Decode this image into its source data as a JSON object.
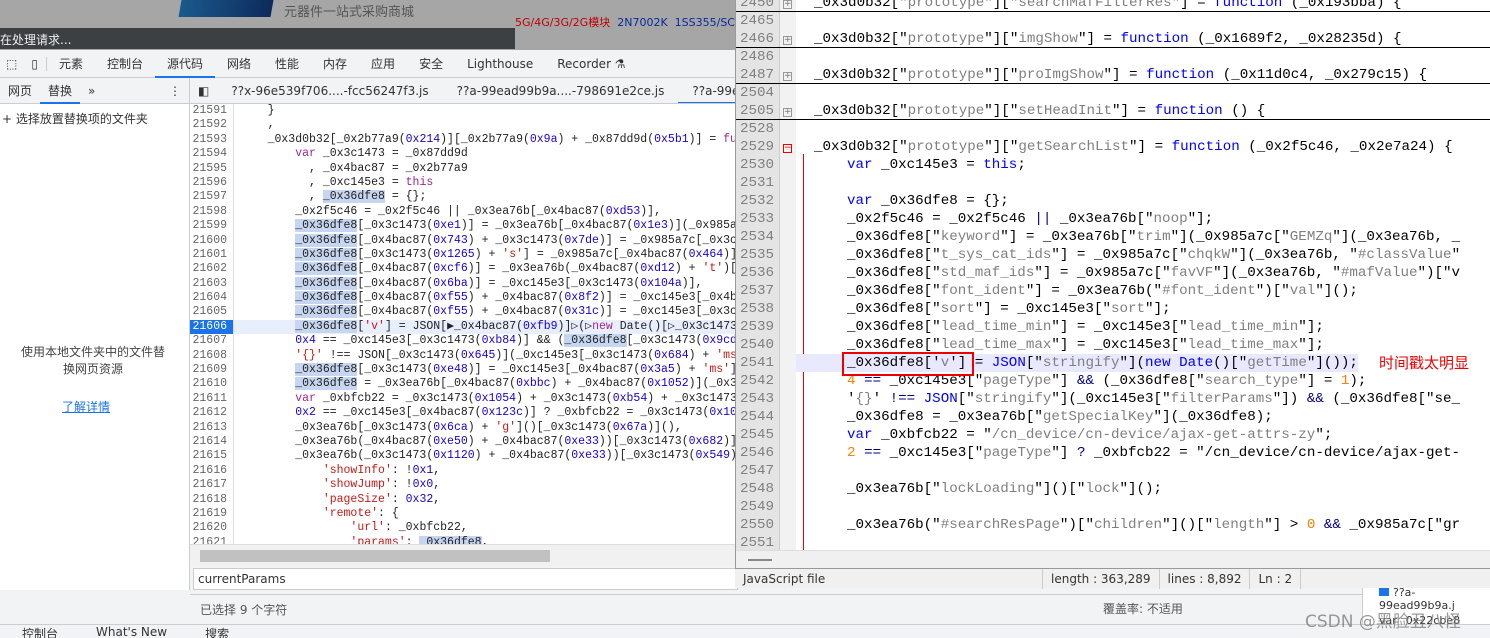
{
  "browser": {
    "slogan": "元器件一站式采购商城",
    "hot_red": "5G/4G/3G/2G模块",
    "hot_links": [
      "2N7002K",
      "1SS355/SC"
    ],
    "loading": "在处理请求..."
  },
  "devtools": {
    "tabs": [
      "元素",
      "控制台",
      "源代码",
      "网络",
      "性能",
      "内存",
      "应用",
      "安全",
      "Lighthouse",
      "Recorder ⚗"
    ],
    "active_tab": "源代码",
    "sub_tabs": [
      "网页",
      "替换",
      "»"
    ],
    "active_sub": "替换",
    "files": [
      "??x-96e539f706....-fcc56247f3.js",
      "??a-99ead99b9a....-798691e2ce.js",
      "??a-99ead99b9a....e"
    ],
    "side": {
      "add_folder": "+ 选择放置替换项的文件夹",
      "desc": "使用本地文件夹中的文件替换网页资源",
      "learn_more": "了解详情"
    },
    "current_line": 21606,
    "code_lines": [
      [
        21591,
        "    }"
      ],
      [
        21592,
        "    ,"
      ],
      [
        21593,
        "    _0x3d0b32[_0x2b77a9(0x214)][_0x2b77a9(0x9a) + _0x87dd9d(0x5b1)] = function"
      ],
      [
        21594,
        "        var _0x3c1473 = _0x87dd9d"
      ],
      [
        21595,
        "          , _0x4bac87 = _0x2b77a9"
      ],
      [
        21596,
        "          , _0xc145e3 = this"
      ],
      [
        21597,
        "          , _0x36dfe8 = {};"
      ],
      [
        21598,
        "        _0x2f5c46 = _0x2f5c46 || _0x3ea76b[_0x4bac87(0xd53)],"
      ],
      [
        21599,
        "        _0x36dfe8[_0x3c1473(0xe1)] = _0x3ea76b[_0x4bac87(0x1e3)](_0x985a7c["
      ],
      [
        21600,
        "        _0x36dfe8[_0x4bac87(0x743) + _0x3c1473(0x7de)] = _0x985a7c[_0x3c147"
      ],
      [
        21601,
        "        _0x36dfe8[_0x3c1473(0x1265) + 's'] = _0x985a7c[_0x4bac87(0x464)](_0"
      ],
      [
        21602,
        "        _0x36dfe8[_0x4bac87(0xcf6)] = _0x3ea76b(_0x4bac87(0xd12) + 't')[_0x"
      ],
      [
        21603,
        "        _0x36dfe8[_0x4bac87(0x6ba)] = _0xc145e3[_0x3c1473(0x104a)],"
      ],
      [
        21604,
        "        _0x36dfe8[_0x4bac87(0xf55) + _0x4bac87(0x8f2)] = _0xc145e3[_0x4bac8"
      ],
      [
        21605,
        "        _0x36dfe8[_0x4bac87(0xf55) + _0x4bac87(0x31c)] = _0xc145e3[_0x3c147"
      ],
      [
        21606,
        "        _0x36dfe8['v'] = JSON[▶_0x4bac87(0xfb9)]▷(▷new Date()[▷_0x3c1473("
      ],
      [
        21607,
        "        0x4 == _0xc145e3[_0x3c1473(0xb84)] && (_0x36dfe8[_0x3c1473(0x9cd) +"
      ],
      [
        21608,
        "        '{}' !== JSON[_0x3c1473(0x645)](_0xc145e3[_0x3c1473(0x684) + 'ms'])"
      ],
      [
        21609,
        "        _0x36dfe8[_0x3c1473(0xe48)] = _0xc145e3[_0x4bac87(0x3a5) + 'ms']),"
      ],
      [
        21610,
        "        _0x36dfe8 = _0x3ea76b[_0x4bac87(0xbbc) + _0x4bac87(0x1052)](_0x36df"
      ],
      [
        21611,
        "        var _0xbfcb22 = _0x3c1473(0x1054) + _0x3c1473(0xb54) + _0x3c1473(0x"
      ],
      [
        21612,
        "        0x2 == _0xc145e3[_0x4bac87(0x123c)] ? _0xbfcb22 = _0x3c1473(0x1054)"
      ],
      [
        21613,
        "        _0x3ea76b[_0x3c1473(0x6ca) + 'g']()[_0x3c1473(0x67a)](),"
      ],
      [
        21614,
        "        _0x3ea76b(_0x4bac87(0xe50) + _0x4bac87(0xe33))[_0x3c1473(0x682)]()["
      ],
      [
        21615,
        "        _0x3ea76b(_0x3c1473(0x1120) + _0x4bac87(0xe33))[_0x3c1473(0x549)]({"
      ],
      [
        21616,
        "            'showInfo': !0x1,"
      ],
      [
        21617,
        "            'showJump': !0x0,"
      ],
      [
        21618,
        "            'pageSize': 0x32,"
      ],
      [
        21619,
        "            'remote': {"
      ],
      [
        21620,
        "                'url': _0xbfcb22,"
      ],
      [
        21621,
        "                'params': _0x36dfe8,"
      ]
    ],
    "search_value": "currentParams",
    "selection_info": "已选择 9 个字符",
    "coverage": "覆盖率: 不适用",
    "mini": {
      "file": "??a-99ead99b9a.j",
      "line": "var _0x22cbe8"
    },
    "drawer": [
      "控制台",
      "What's New",
      "搜索"
    ]
  },
  "editor": {
    "lines": [
      [
        2450,
        "_0x3d0b32[\"prototype\"][\"searchMafFilterRes\"] = function (_0x193bba) {",
        "collapsed"
      ],
      [
        2465,
        "",
        ""
      ],
      [
        2466,
        "_0x3d0b32[\"prototype\"][\"imgShow\"] = function (_0x1689f2, _0x28235d) {",
        "collapsed"
      ],
      [
        2486,
        "",
        ""
      ],
      [
        2487,
        "_0x3d0b32[\"prototype\"][\"proImgShow\"] = function (_0x11d0c4, _0x279c15) {",
        "collapsed"
      ],
      [
        2504,
        "",
        ""
      ],
      [
        2505,
        "_0x3d0b32[\"prototype\"][\"setHeadInit\"] = function () {",
        "collapsed"
      ],
      [
        2528,
        "",
        ""
      ],
      [
        2529,
        "_0x3d0b32[\"prototype\"][\"getSearchList\"] = function (_0x2f5c46, _0x2e7a24) {",
        "open"
      ],
      [
        2530,
        "  var _0xc145e3 = this;",
        ""
      ],
      [
        2531,
        "",
        ""
      ],
      [
        2532,
        "  var _0x36dfe8 = {};",
        ""
      ],
      [
        2533,
        "  _0x2f5c46 = _0x2f5c46 || _0x3ea76b[\"noop\"];",
        ""
      ],
      [
        2534,
        "  _0x36dfe8[\"keyword\"] = _0x3ea76b[\"trim\"](_0x985a7c[\"GEMZq\"](_0x3ea76b, _",
        ""
      ],
      [
        2535,
        "  _0x36dfe8[\"t_sys_cat_ids\"] = _0x985a7c[\"chqkW\"](_0x3ea76b, \"#classValue\"",
        ""
      ],
      [
        2536,
        "  _0x36dfe8[\"std_maf_ids\"] = _0x985a7c[\"favVF\"](_0x3ea76b, \"#mafValue\")[\"v",
        ""
      ],
      [
        2537,
        "  _0x36dfe8[\"font_ident\"] = _0x3ea76b(\"#font_ident\")[\"val\"]();",
        ""
      ],
      [
        2538,
        "  _0x36dfe8[\"sort\"] = _0xc145e3[\"sort\"];",
        ""
      ],
      [
        2539,
        "  _0x36dfe8[\"lead_time_min\"] = _0xc145e3[\"lead_time_min\"];",
        ""
      ],
      [
        2540,
        "  _0x36dfe8[\"lead_time_max\"] = _0xc145e3[\"lead_time_max\"];",
        ""
      ],
      [
        2541,
        "  _0x36dfe8['v'] = JSON[\"stringify\"](new Date()[\"getTime\"]());",
        "cur"
      ],
      [
        2542,
        "  4 == _0xc145e3[\"pageType\"] && (_0x36dfe8[\"search_type\"] = 1);",
        ""
      ],
      [
        2543,
        "  '{}' !== JSON[\"stringify\"](_0xc145e3[\"filterParams\"]) && (_0x36dfe8[\"se_",
        ""
      ],
      [
        2544,
        "  _0x36dfe8 = _0x3ea76b[\"getSpecialKey\"](_0x36dfe8);",
        ""
      ],
      [
        2545,
        "  var _0xbfcb22 = \"/cn_device/cn-device/ajax-get-attrs-zy\";",
        ""
      ],
      [
        2546,
        "  2 == _0xc145e3[\"pageType\"] ? _0xbfcb22 = \"/cn_device/cn-device/ajax-get-",
        ""
      ],
      [
        2547,
        "",
        ""
      ],
      [
        2548,
        "  _0x3ea76b[\"lockLoading\"]()[\"lock\"]();",
        ""
      ],
      [
        2549,
        "",
        ""
      ],
      [
        2550,
        "  _0x3ea76b(\"#searchResPage\")[\"children\"]()[\"length\"] > 0 && _0x985a7c[\"gr",
        ""
      ],
      [
        2551,
        "",
        ""
      ]
    ],
    "annotation": "时间戳太明显",
    "status": {
      "type": "JavaScript file",
      "length": "length : 363,289",
      "lines": "lines : 8,892",
      "ln": "Ln : 2"
    }
  },
  "watermark": "CSDN @黑脸丑八怪",
  "colors": {
    "accent": "#1a73e8",
    "annotation": "#ee0000"
  }
}
